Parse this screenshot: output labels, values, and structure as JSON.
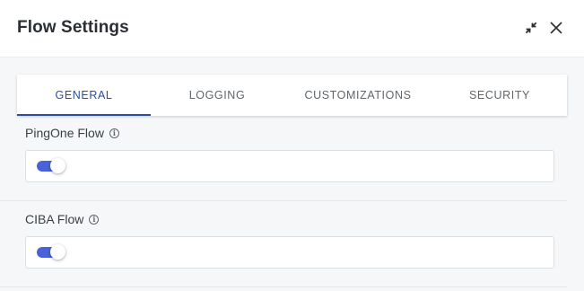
{
  "header": {
    "title": "Flow Settings"
  },
  "tabs": [
    {
      "label": "GENERAL",
      "active": true
    },
    {
      "label": "LOGGING",
      "active": false
    },
    {
      "label": "CUSTOMIZATIONS",
      "active": false
    },
    {
      "label": "SECURITY",
      "active": false
    }
  ],
  "settings": [
    {
      "label": "PingOne Flow",
      "info_icon": "info-icon",
      "toggle_on": true
    },
    {
      "label": "CIBA Flow",
      "info_icon": "info-icon",
      "toggle_on": true
    }
  ],
  "colors": {
    "accent": "#2c4ea1",
    "toggle_track": "#4863d8",
    "body_background": "#f6f7f8"
  },
  "icons": {
    "expand": "collapse-arrows-icon",
    "close": "close-icon"
  }
}
